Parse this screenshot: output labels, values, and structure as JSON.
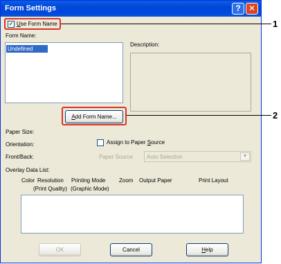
{
  "window": {
    "title": "Form Settings"
  },
  "titlebar": {
    "help_glyph": "?",
    "close_glyph": "✕"
  },
  "use_form_name": {
    "label": "Use Form Name",
    "checked": true
  },
  "form_name": {
    "label": "Form Name:",
    "items": [
      "Undefined"
    ],
    "selected": "Undefined"
  },
  "description": {
    "label": "Description:"
  },
  "add_form_name_button": "Add Form Name...",
  "paper_size": {
    "label": "Paper Size:"
  },
  "orientation": {
    "label": "Orientation:"
  },
  "assign_to_paper_source": {
    "label": "Assign to Paper Source",
    "checked": false
  },
  "front_back": {
    "label": "Front/Back:"
  },
  "paper_source": {
    "label": "Paper Source",
    "value": "Auto Selection"
  },
  "overlay": {
    "label": "Overlay Data List:",
    "columns": {
      "color": "Color",
      "resolution": "Resolution",
      "print_quality": "(Print Quality)",
      "printing_mode": "Printing Mode",
      "graphic_mode": "(Graphic Mode)",
      "zoom": "Zoom",
      "output_paper": "Output Paper",
      "print_layout": "Print Layout"
    }
  },
  "buttons": {
    "ok": "OK",
    "cancel": "Cancel",
    "help": "Help"
  },
  "callouts": {
    "one": "1",
    "two": "2"
  },
  "colors": {
    "callout_red": "#d9322a",
    "title_blue": "#0147d6",
    "selection_blue": "#316ac5"
  }
}
